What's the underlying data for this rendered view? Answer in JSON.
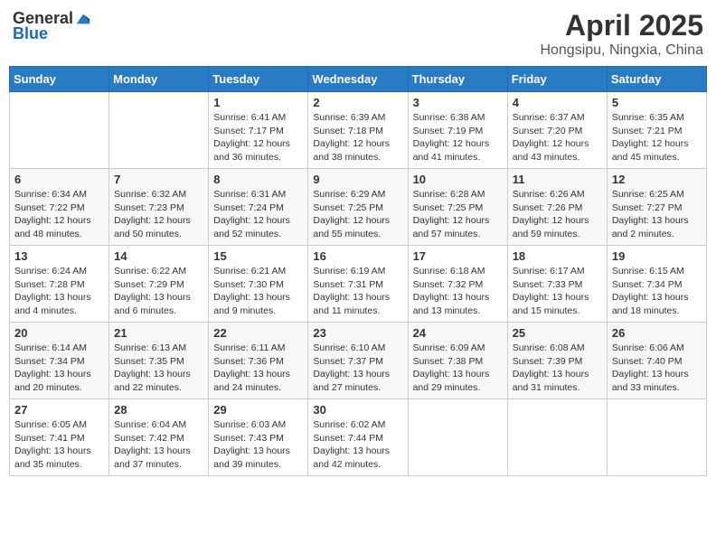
{
  "header": {
    "logo_general": "General",
    "logo_blue": "Blue",
    "title": "April 2025",
    "subtitle": "Hongsipu, Ningxia, China"
  },
  "days_of_week": [
    "Sunday",
    "Monday",
    "Tuesday",
    "Wednesday",
    "Thursday",
    "Friday",
    "Saturday"
  ],
  "weeks": [
    [
      {
        "num": "",
        "info": ""
      },
      {
        "num": "",
        "info": ""
      },
      {
        "num": "1",
        "info": "Sunrise: 6:41 AM\nSunset: 7:17 PM\nDaylight: 12 hours and 36 minutes."
      },
      {
        "num": "2",
        "info": "Sunrise: 6:39 AM\nSunset: 7:18 PM\nDaylight: 12 hours and 38 minutes."
      },
      {
        "num": "3",
        "info": "Sunrise: 6:38 AM\nSunset: 7:19 PM\nDaylight: 12 hours and 41 minutes."
      },
      {
        "num": "4",
        "info": "Sunrise: 6:37 AM\nSunset: 7:20 PM\nDaylight: 12 hours and 43 minutes."
      },
      {
        "num": "5",
        "info": "Sunrise: 6:35 AM\nSunset: 7:21 PM\nDaylight: 12 hours and 45 minutes."
      }
    ],
    [
      {
        "num": "6",
        "info": "Sunrise: 6:34 AM\nSunset: 7:22 PM\nDaylight: 12 hours and 48 minutes."
      },
      {
        "num": "7",
        "info": "Sunrise: 6:32 AM\nSunset: 7:23 PM\nDaylight: 12 hours and 50 minutes."
      },
      {
        "num": "8",
        "info": "Sunrise: 6:31 AM\nSunset: 7:24 PM\nDaylight: 12 hours and 52 minutes."
      },
      {
        "num": "9",
        "info": "Sunrise: 6:29 AM\nSunset: 7:25 PM\nDaylight: 12 hours and 55 minutes."
      },
      {
        "num": "10",
        "info": "Sunrise: 6:28 AM\nSunset: 7:25 PM\nDaylight: 12 hours and 57 minutes."
      },
      {
        "num": "11",
        "info": "Sunrise: 6:26 AM\nSunset: 7:26 PM\nDaylight: 12 hours and 59 minutes."
      },
      {
        "num": "12",
        "info": "Sunrise: 6:25 AM\nSunset: 7:27 PM\nDaylight: 13 hours and 2 minutes."
      }
    ],
    [
      {
        "num": "13",
        "info": "Sunrise: 6:24 AM\nSunset: 7:28 PM\nDaylight: 13 hours and 4 minutes."
      },
      {
        "num": "14",
        "info": "Sunrise: 6:22 AM\nSunset: 7:29 PM\nDaylight: 13 hours and 6 minutes."
      },
      {
        "num": "15",
        "info": "Sunrise: 6:21 AM\nSunset: 7:30 PM\nDaylight: 13 hours and 9 minutes."
      },
      {
        "num": "16",
        "info": "Sunrise: 6:19 AM\nSunset: 7:31 PM\nDaylight: 13 hours and 11 minutes."
      },
      {
        "num": "17",
        "info": "Sunrise: 6:18 AM\nSunset: 7:32 PM\nDaylight: 13 hours and 13 minutes."
      },
      {
        "num": "18",
        "info": "Sunrise: 6:17 AM\nSunset: 7:33 PM\nDaylight: 13 hours and 15 minutes."
      },
      {
        "num": "19",
        "info": "Sunrise: 6:15 AM\nSunset: 7:34 PM\nDaylight: 13 hours and 18 minutes."
      }
    ],
    [
      {
        "num": "20",
        "info": "Sunrise: 6:14 AM\nSunset: 7:34 PM\nDaylight: 13 hours and 20 minutes."
      },
      {
        "num": "21",
        "info": "Sunrise: 6:13 AM\nSunset: 7:35 PM\nDaylight: 13 hours and 22 minutes."
      },
      {
        "num": "22",
        "info": "Sunrise: 6:11 AM\nSunset: 7:36 PM\nDaylight: 13 hours and 24 minutes."
      },
      {
        "num": "23",
        "info": "Sunrise: 6:10 AM\nSunset: 7:37 PM\nDaylight: 13 hours and 27 minutes."
      },
      {
        "num": "24",
        "info": "Sunrise: 6:09 AM\nSunset: 7:38 PM\nDaylight: 13 hours and 29 minutes."
      },
      {
        "num": "25",
        "info": "Sunrise: 6:08 AM\nSunset: 7:39 PM\nDaylight: 13 hours and 31 minutes."
      },
      {
        "num": "26",
        "info": "Sunrise: 6:06 AM\nSunset: 7:40 PM\nDaylight: 13 hours and 33 minutes."
      }
    ],
    [
      {
        "num": "27",
        "info": "Sunrise: 6:05 AM\nSunset: 7:41 PM\nDaylight: 13 hours and 35 minutes."
      },
      {
        "num": "28",
        "info": "Sunrise: 6:04 AM\nSunset: 7:42 PM\nDaylight: 13 hours and 37 minutes."
      },
      {
        "num": "29",
        "info": "Sunrise: 6:03 AM\nSunset: 7:43 PM\nDaylight: 13 hours and 39 minutes."
      },
      {
        "num": "30",
        "info": "Sunrise: 6:02 AM\nSunset: 7:44 PM\nDaylight: 13 hours and 42 minutes."
      },
      {
        "num": "",
        "info": ""
      },
      {
        "num": "",
        "info": ""
      },
      {
        "num": "",
        "info": ""
      }
    ]
  ]
}
